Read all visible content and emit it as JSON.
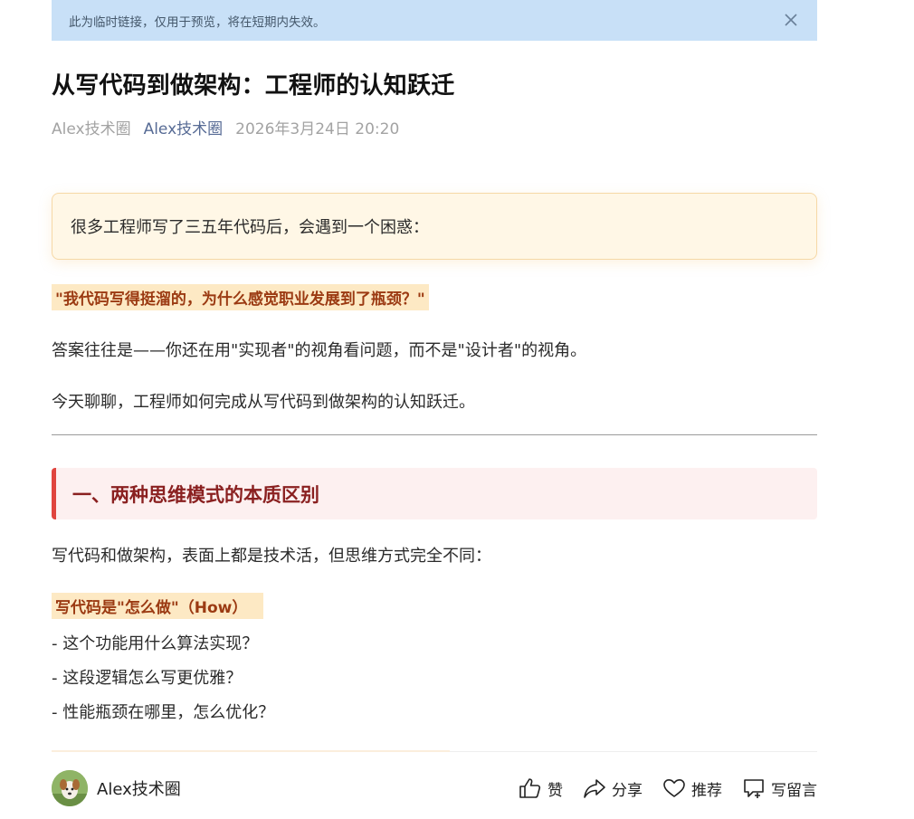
{
  "banner": {
    "text": "此为临时链接，仅用于预览，将在短期内失效。",
    "close_icon": "close-icon"
  },
  "article": {
    "title": "从写代码到做架构：工程师的认知跃迁",
    "author": "Alex技术圈",
    "account": "Alex技术圈",
    "date": "2026年3月24日 20:20",
    "intro": "很多工程师写了三五年代码后，会遇到一个困惑：",
    "quote": "\"我代码写得挺溜的，为什么感觉职业发展到了瓶颈？\"",
    "para1": "答案往往是——你还在用\"实现者\"的视角看问题，而不是\"设计者\"的视角。",
    "para2": "今天聊聊，工程师如何完成从写代码到做架构的认知跃迁。",
    "section1_title": "一、两种思维模式的本质区别",
    "section1_intro": "写代码和做架构，表面上都是技术活，但思维方式完全不同：",
    "subhead1": "写代码是\"怎么做\"（How）",
    "list1": [
      "- 这个功能用什么算法实现？",
      "- 这段逻辑怎么写更优雅？",
      "- 性能瓶颈在哪里，怎么优化？"
    ]
  },
  "footer": {
    "name": "Alex技术圈",
    "like_label": "赞",
    "share_label": "分享",
    "recommend_label": "推荐",
    "comment_label": "写留言"
  },
  "colors": {
    "banner_bg": "#c8e0f7",
    "highlight_bg": "#fde9c4",
    "highlight_text": "#9b3a12",
    "section_accent": "#e0453f",
    "account_link": "#576b95"
  }
}
